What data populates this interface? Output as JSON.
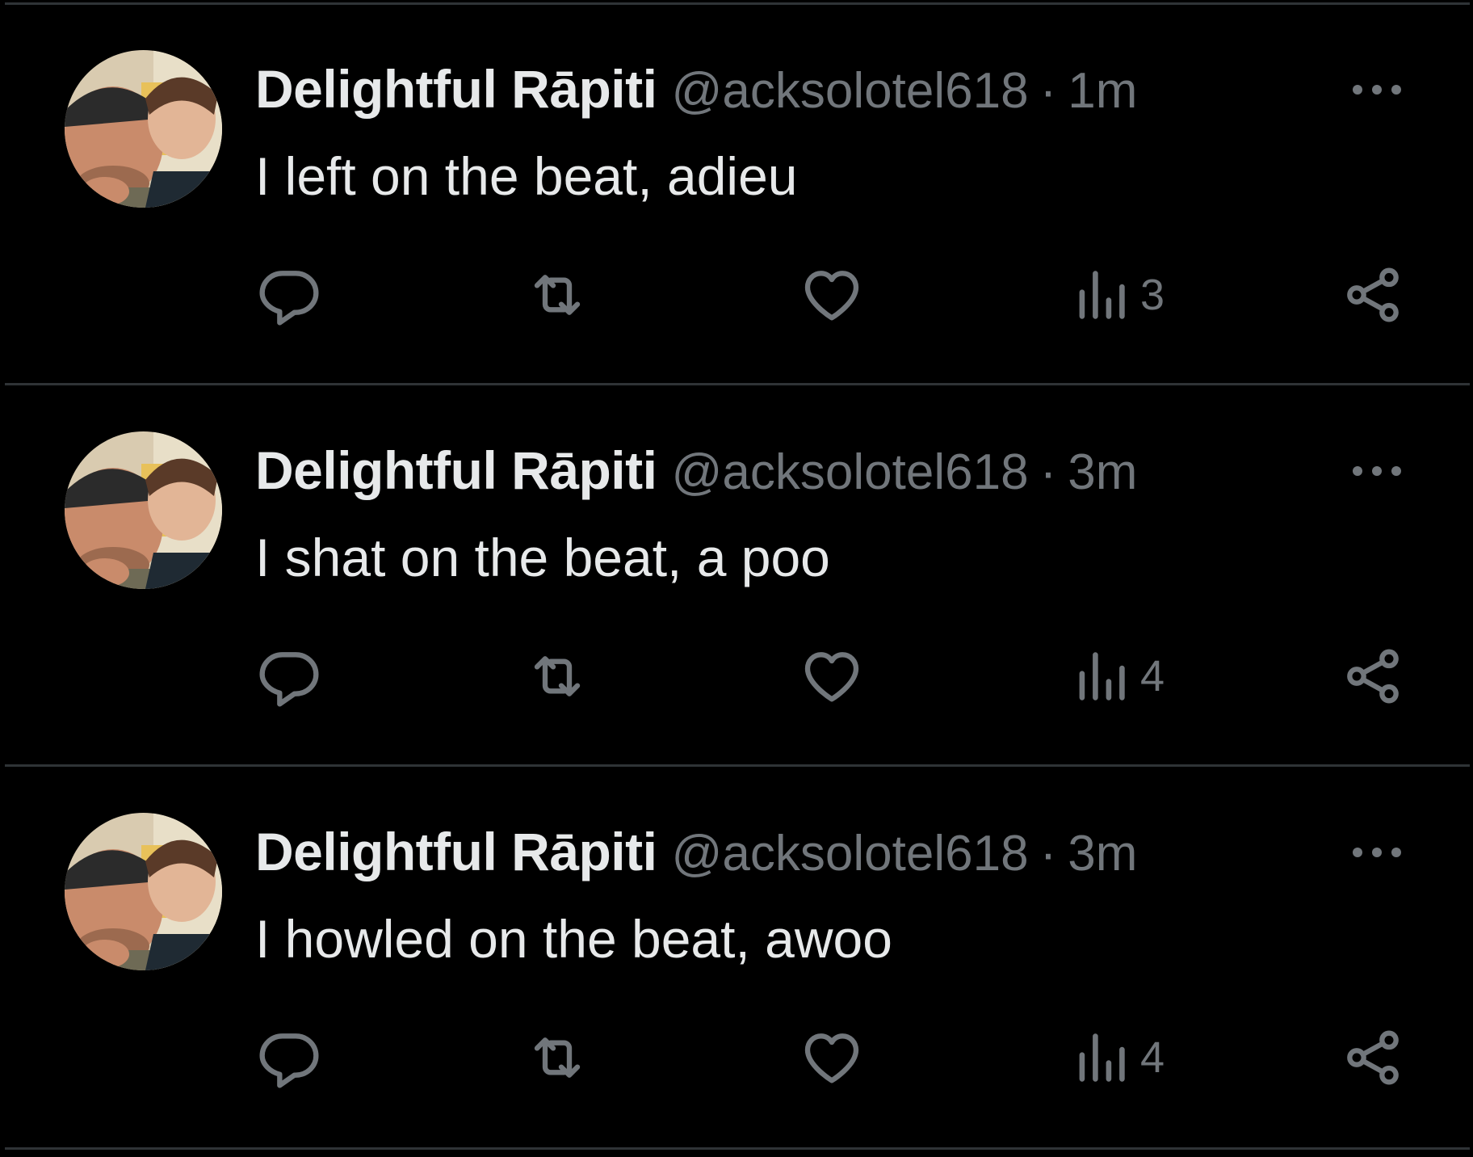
{
  "tweets": [
    {
      "display_name": "Delightful Rāpiti",
      "handle": "@acksolotel618",
      "separator": "·",
      "time": "1m",
      "text": "I left on the beat, adieu",
      "views": "3"
    },
    {
      "display_name": "Delightful Rāpiti",
      "handle": "@acksolotel618",
      "separator": "·",
      "time": "3m",
      "text": "I shat on the beat, a poo",
      "views": "4"
    },
    {
      "display_name": "Delightful Rāpiti",
      "handle": "@acksolotel618",
      "separator": "·",
      "time": "3m",
      "text": "I howled on the beat, awoo",
      "views": "4"
    }
  ],
  "icons": {
    "reply": "reply-icon",
    "retweet": "retweet-icon",
    "like": "like-icon",
    "views": "views-icon",
    "share": "share-icon",
    "more": "more-icon"
  },
  "colors": {
    "background": "#000000",
    "primary_text": "#e7e9ea",
    "secondary_text": "#71767b",
    "divider": "#2f3336"
  }
}
